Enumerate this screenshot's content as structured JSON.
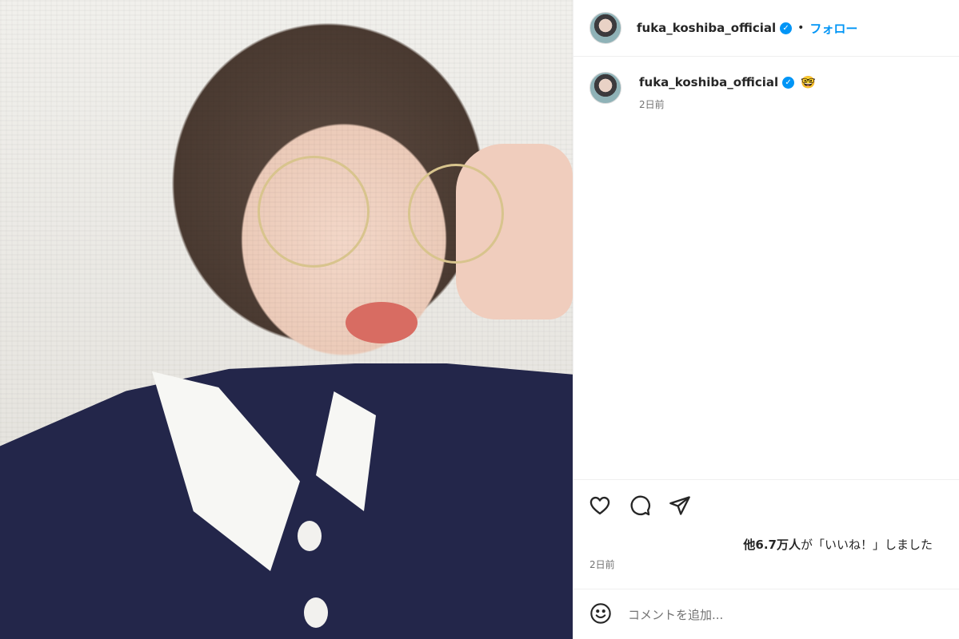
{
  "post": {
    "photo_icon": "portrait-photo",
    "header": {
      "username": "fuka_koshiba_official",
      "verified_icon": "verified-badge-icon",
      "separator": "•",
      "follow_label": "フォロー"
    },
    "caption": {
      "username": "fuka_koshiba_official",
      "emoji": "🤓",
      "time": "2日前"
    },
    "actions": {
      "like_icon": "heart-icon",
      "comment_icon": "comment-icon",
      "share_icon": "share-icon"
    },
    "likes": {
      "prefix": "他",
      "count": "6.7万人",
      "suffix": "が「いいね！」しました"
    },
    "post_time": "2日前",
    "comment": {
      "emoji_icon": "smiley-icon",
      "placeholder": "コメントを追加..."
    }
  },
  "colors": {
    "accent": "#0095f6",
    "text": "#262626",
    "muted": "#737373",
    "border": "#efefef"
  }
}
